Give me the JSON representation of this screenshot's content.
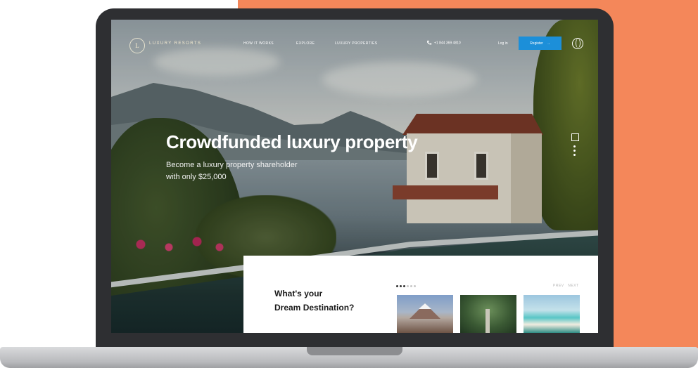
{
  "site": {
    "logo_initial": "L",
    "logo_text": "LUXURY RESORTS"
  },
  "nav": {
    "links": [
      "HOW IT WORKS",
      "EXPLORE",
      "LUXURY PROPERTIES"
    ],
    "phone": "+1 844 369 4810",
    "login_label": "Log in",
    "register_label": "Register",
    "register_arrow": "→"
  },
  "hero": {
    "title": "Crowdfunded luxury property",
    "subtitle_line1": "Become a luxury property shareholder",
    "subtitle_line2": "with only $25,000"
  },
  "destination_card": {
    "title_line1": "What's your",
    "title_line2": "Dream Destination?",
    "carousel_dots": 6,
    "active_dot": 0,
    "prev_label": "PREV",
    "next_label": "NEXT",
    "thumbnails": [
      "mountain",
      "forest",
      "beach"
    ]
  },
  "colors": {
    "orange_background": "#f4875a",
    "register_button": "#1c8fd9",
    "laptop_frame": "#2e2f32"
  },
  "icons": [
    "phone-icon",
    "globe-icon",
    "side-scroll-icon"
  ]
}
